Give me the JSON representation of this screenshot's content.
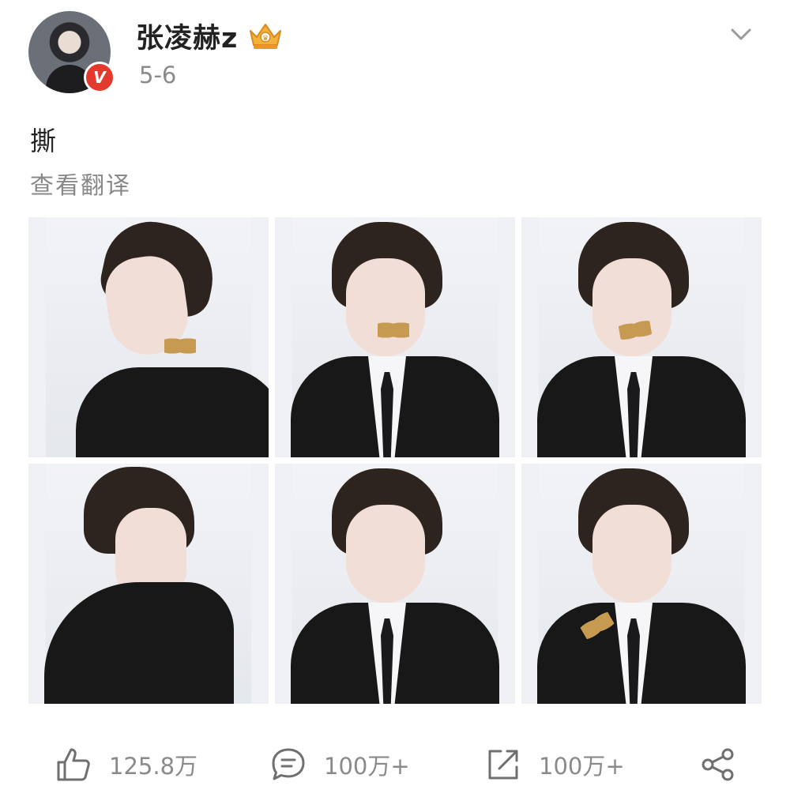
{
  "post": {
    "author": {
      "name": "张凌赫z",
      "verified_badge": "V",
      "avatar_icon": "user-avatar",
      "member_icon": "crown-icon"
    },
    "date": "5-6",
    "text": "撕",
    "translate_label": "查看翻译",
    "more_icon": "chevron-down-icon"
  },
  "photos": [
    {
      "index": 1,
      "pose": "profile-left"
    },
    {
      "index": 2,
      "pose": "front-butterfly"
    },
    {
      "index": 3,
      "pose": "front-cheek"
    },
    {
      "index": 4,
      "pose": "over-shoulder"
    },
    {
      "index": 5,
      "pose": "front"
    },
    {
      "index": 6,
      "pose": "front-hand"
    }
  ],
  "actions": {
    "like": {
      "icon": "thumbs-up-icon",
      "count": "125.8万"
    },
    "comment": {
      "icon": "comment-icon",
      "count": "100万+"
    },
    "repost": {
      "icon": "repost-icon",
      "count": "100万+"
    },
    "share": {
      "icon": "share-icon"
    }
  },
  "colors": {
    "verified": "#e23a2c",
    "crown": "#f0a830",
    "secondary_text": "#8a8a8a"
  }
}
